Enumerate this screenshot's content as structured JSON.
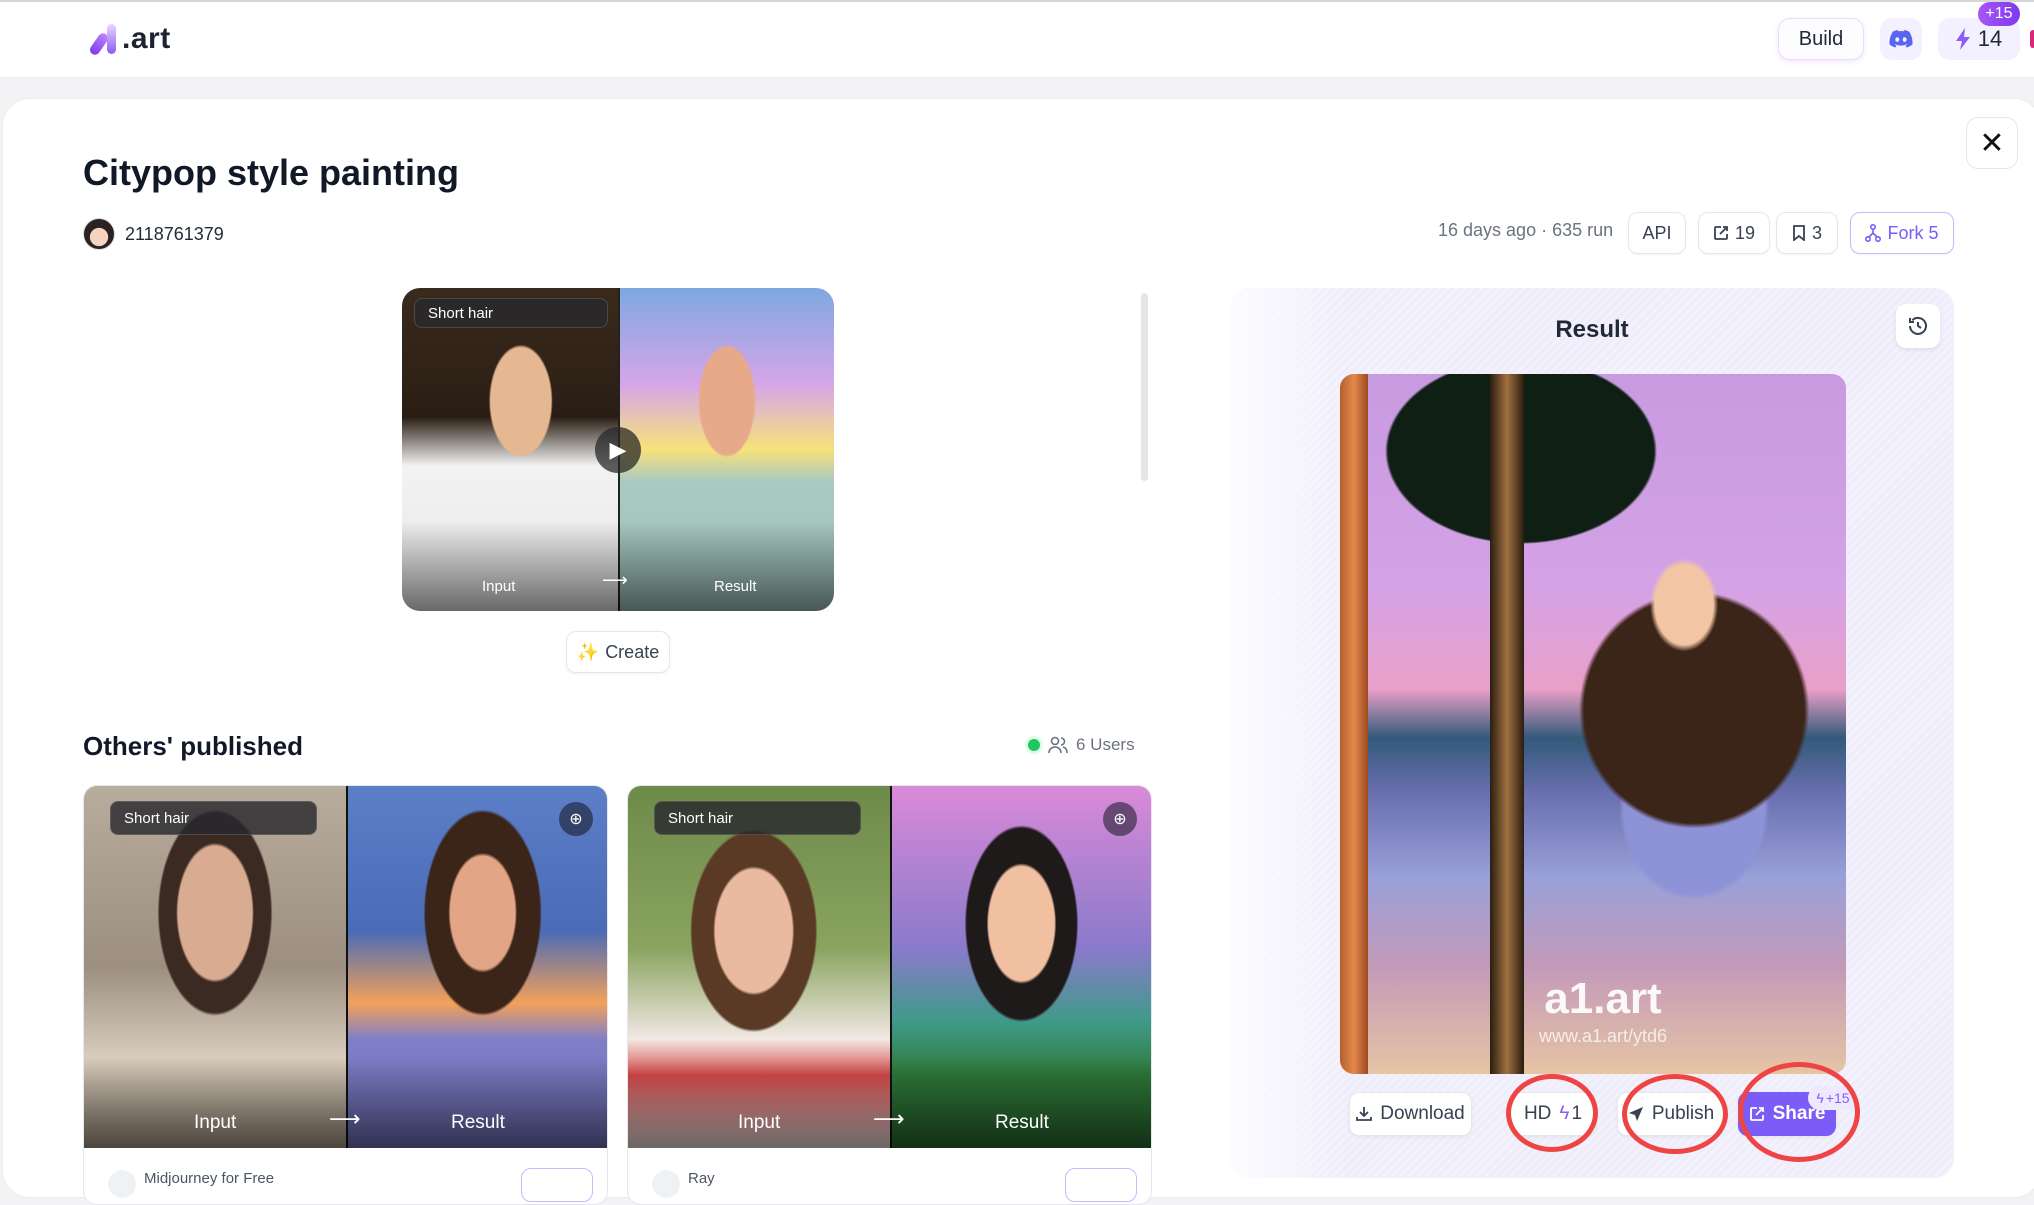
{
  "header": {
    "logo_text": ".art",
    "build_label": "Build",
    "discord_icon": "discord-icon",
    "credits_value": "14",
    "credits_badge": "+15"
  },
  "page": {
    "title": "Citypop style painting",
    "author": "2118761379",
    "meta": "16 days ago · 635 run",
    "api_label": "API",
    "shares_count": "19",
    "bookmarks_count": "3",
    "fork_label": "Fork 5"
  },
  "hero": {
    "tag": "Short hair",
    "input_label": "Input",
    "result_label": "Result",
    "arrow": "⟶",
    "create_label": "Create"
  },
  "others": {
    "title": "Others' published",
    "users_label": "6 Users",
    "cards": [
      {
        "tag": "Short hair",
        "input_label": "Input",
        "result_label": "Result",
        "author": "Midjourney for Free"
      },
      {
        "tag": "Short hair",
        "input_label": "Input",
        "result_label": "Result",
        "author": "Ray"
      }
    ]
  },
  "result": {
    "title": "Result",
    "watermark": "a1.art",
    "watermark_url": "www.a1.art/ytd6",
    "download_label": "Download",
    "hd_label": "HD",
    "hd_cost": "1",
    "publish_label": "Publish",
    "share_label": "Share",
    "share_badge": "+15"
  },
  "colors": {
    "accent": "#7c5cf6",
    "annotation_ring": "#ef4444",
    "online": "#22c55e"
  }
}
